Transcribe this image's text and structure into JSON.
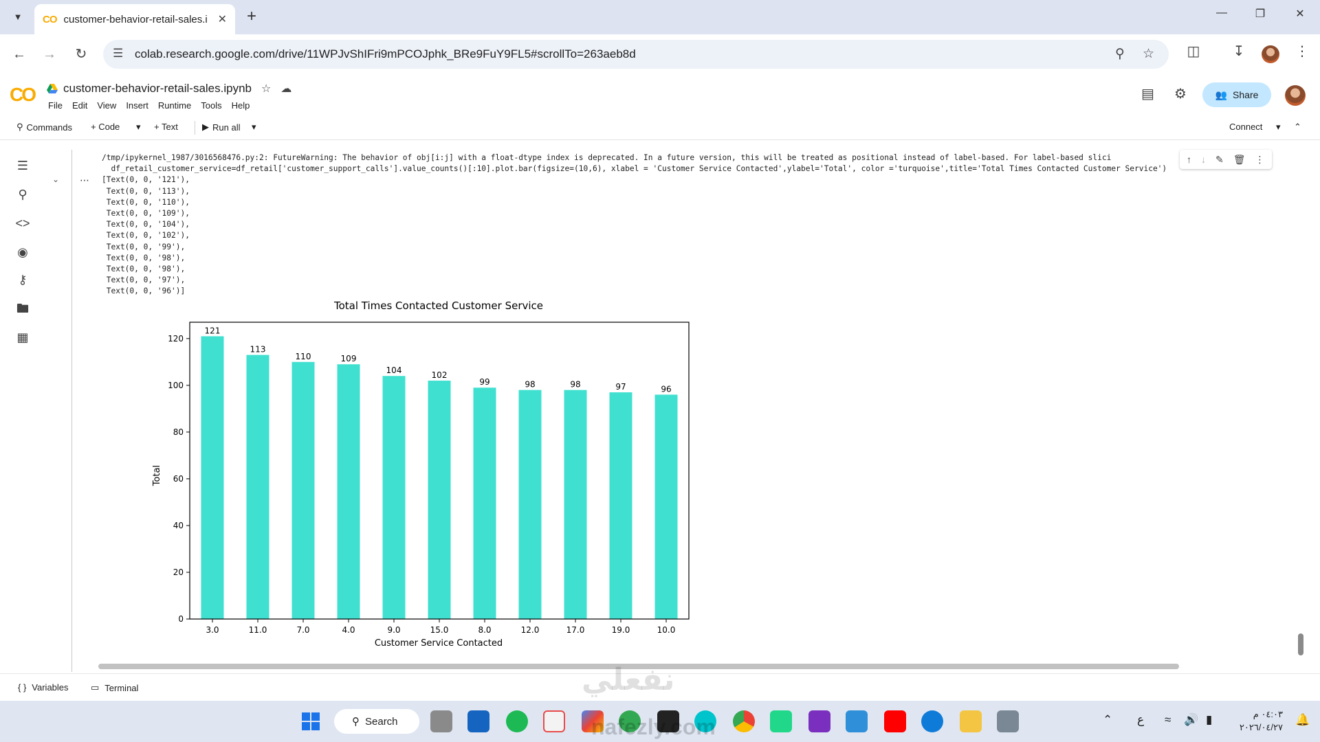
{
  "browser": {
    "tab_title": "customer-behavior-retail-sales.i",
    "url": "colab.research.google.com/drive/11WPJvShIFri9mPCOJphk_BRe9FuY9FL5#scrollTo=263aeb8d"
  },
  "colab": {
    "logo": "CO",
    "notebook_name": "customer-behavior-retail-sales.ipynb",
    "menu": [
      "File",
      "Edit",
      "View",
      "Insert",
      "Runtime",
      "Tools",
      "Help"
    ],
    "share_label": "Share",
    "toolbar": {
      "commands": "Commands",
      "code": "+ Code",
      "text": "+ Text",
      "run_all": "Run all",
      "connect": "Connect"
    }
  },
  "output": {
    "warning_line1": "/tmp/ipykernel_1987/3016568476.py:2: FutureWarning: The behavior of obj[i:j] with a float-dtype index is deprecated. In a future version, this will be treated as positional instead of label-based. For label-based slici",
    "warning_line2": "  df_retail_customer_service=df_retail['customer_support_calls'].value_counts()[:10].plot.bar(figsize=(10,6), xlabel = 'Customer Service Contacted',ylabel='Total', color ='turquoise',title='Total Times Contacted Customer Service')",
    "text_lines": [
      "[Text(0, 0, '121'),",
      " Text(0, 0, '113'),",
      " Text(0, 0, '110'),",
      " Text(0, 0, '109'),",
      " Text(0, 0, '104'),",
      " Text(0, 0, '102'),",
      " Text(0, 0, '99'),",
      " Text(0, 0, '98'),",
      " Text(0, 0, '98'),",
      " Text(0, 0, '97'),",
      " Text(0, 0, '96')]"
    ]
  },
  "chart_data": {
    "type": "bar",
    "title": "Total Times Contacted Customer Service",
    "xlabel": "Customer Service Contacted",
    "ylabel": "Total",
    "categories": [
      "3.0",
      "11.0",
      "7.0",
      "4.0",
      "9.0",
      "15.0",
      "8.0",
      "12.0",
      "17.0",
      "19.0",
      "10.0"
    ],
    "values": [
      121,
      113,
      110,
      109,
      104,
      102,
      99,
      98,
      98,
      97,
      96
    ],
    "data_labels": [
      "121",
      "113",
      "110",
      "109",
      "104",
      "102",
      "99",
      "98",
      "98",
      "97",
      "96"
    ],
    "yticks": [
      0,
      20,
      40,
      60,
      80,
      100,
      120
    ],
    "ylim": [
      0,
      127
    ],
    "color": "#40e0d0",
    "grid": false
  },
  "bottom": {
    "variables": "Variables",
    "terminal": "Terminal"
  },
  "taskbar": {
    "search": "Search",
    "clock_time": "٠٤:٠٣ م",
    "clock_date": "٢٠٢٦/٠٤/٢٧",
    "lang": "ع"
  },
  "watermark": {
    "arabic": "نفعلي",
    "latin": "nafezly.com"
  }
}
